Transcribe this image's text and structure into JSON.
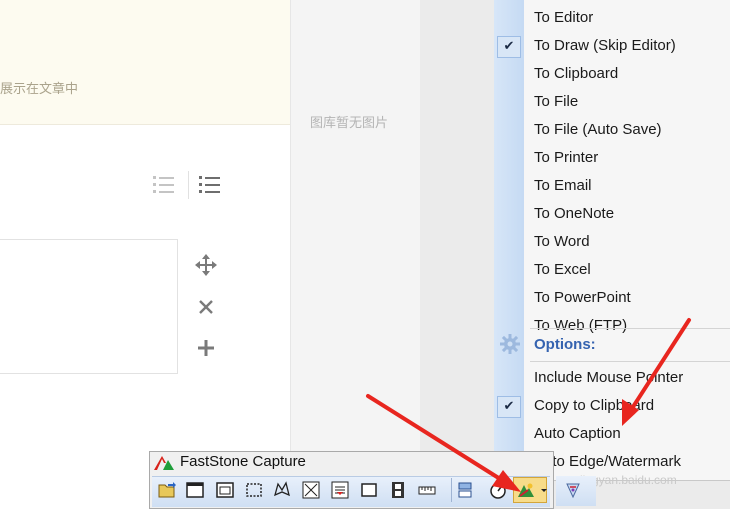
{
  "editor": {
    "notice_text": "展示在文章中",
    "gallery_empty": "图库暂无图片"
  },
  "menu": {
    "items": [
      {
        "label": "To Editor",
        "checked": false
      },
      {
        "label": "To Draw (Skip Editor)",
        "checked": true
      },
      {
        "label": "To Clipboard",
        "checked": false
      },
      {
        "label": "To File",
        "checked": false
      },
      {
        "label": "To File (Auto Save)",
        "checked": false
      },
      {
        "label": "To Printer",
        "checked": false
      },
      {
        "label": "To Email",
        "checked": false
      },
      {
        "label": "To OneNote",
        "checked": false
      },
      {
        "label": "To Word",
        "checked": false
      },
      {
        "label": "To Excel",
        "checked": false
      },
      {
        "label": "To PowerPoint",
        "checked": false
      },
      {
        "label": "To Web (FTP)",
        "checked": false
      }
    ],
    "options_header": "Options:",
    "options": [
      {
        "label": "Include Mouse Pointer",
        "checked": false
      },
      {
        "label": "Copy to Clipboard",
        "checked": true
      },
      {
        "label": "Auto Caption",
        "checked": false
      },
      {
        "label": "Auto Edge/Watermark",
        "checked": false
      }
    ]
  },
  "faststone": {
    "title": "FastStone Capture",
    "tools": [
      "open-icon",
      "window-icon",
      "object-icon",
      "rectangle-icon",
      "freehand-icon",
      "fullscreen-icon",
      "scrolling-icon",
      "fixed-region-icon",
      "video-icon",
      "ruler-icon",
      "output-icon",
      "timer-icon",
      "destination-icon",
      "settings-icon"
    ]
  },
  "watermark": "jingyan.baidu.com",
  "colors": {
    "accent_blue": "#3563b0",
    "arrow_red": "#e8261f",
    "notice_bg": "#fdfbf0"
  }
}
